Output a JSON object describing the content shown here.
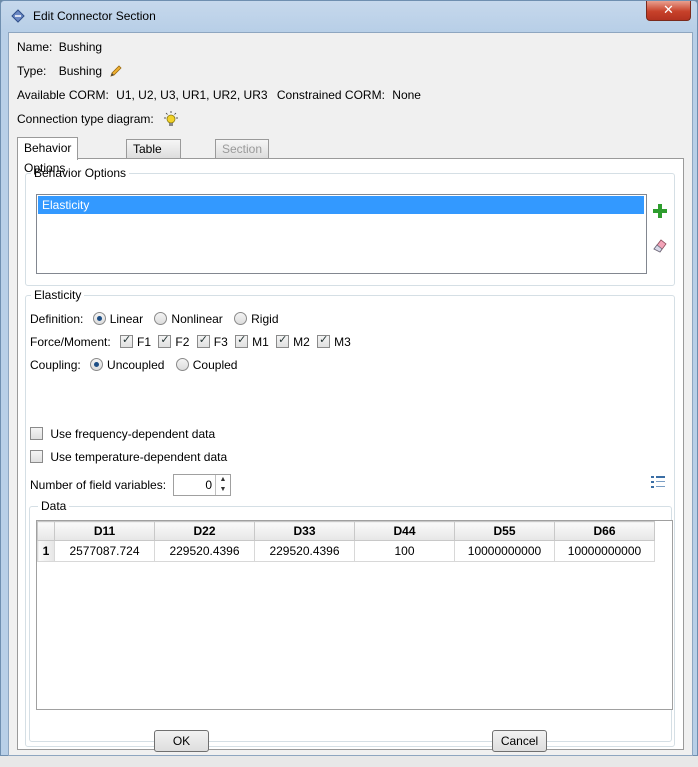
{
  "window": {
    "title": "Edit Connector Section",
    "close_label": "✕"
  },
  "info": {
    "name_label": "Name:",
    "name_value": "Bushing",
    "type_label": "Type:",
    "type_value": "Bushing",
    "available_corm_label": "Available CORM:",
    "available_corm_value": "U1, U2, U3, UR1, UR2, UR3",
    "constrained_corm_label": "Constrained CORM:",
    "constrained_corm_value": "None",
    "diagram_label": "Connection type diagram:"
  },
  "tabs": [
    {
      "label": "Behavior Options",
      "state": "active"
    },
    {
      "label": "Table Options",
      "state": "normal"
    },
    {
      "label": "Section Data",
      "state": "disabled"
    }
  ],
  "behavior_options": {
    "group_label": "Behavior Options",
    "items": [
      "Elasticity"
    ],
    "selected": "Elasticity"
  },
  "elasticity": {
    "group_label": "Elasticity",
    "definition_label": "Definition:",
    "definition_options": [
      "Linear",
      "Nonlinear",
      "Rigid"
    ],
    "definition_selected": "Linear",
    "force_moment_label": "Force/Moment:",
    "force_moment_options": [
      {
        "label": "F1",
        "checked": true
      },
      {
        "label": "F2",
        "checked": true
      },
      {
        "label": "F3",
        "checked": true
      },
      {
        "label": "M1",
        "checked": true
      },
      {
        "label": "M2",
        "checked": true
      },
      {
        "label": "M3",
        "checked": true
      }
    ],
    "coupling_label": "Coupling:",
    "coupling_options": [
      "Uncoupled",
      "Coupled"
    ],
    "coupling_selected": "Uncoupled",
    "freq_dependent_label": "Use frequency-dependent data",
    "freq_dependent_checked": false,
    "temp_dependent_label": "Use temperature-dependent data",
    "temp_dependent_checked": false,
    "field_vars_label": "Number of field variables:",
    "field_vars_value": "0"
  },
  "data_table": {
    "group_label": "Data",
    "columns": [
      "D11",
      "D22",
      "D33",
      "D44",
      "D55",
      "D66"
    ],
    "rows": [
      {
        "index": "1",
        "cells": [
          "2577087.724",
          "229520.4396",
          "229520.4396",
          "100",
          "10000000000",
          "10000000000"
        ]
      }
    ]
  },
  "footer": {
    "ok_label": "OK",
    "cancel_label": "Cancel"
  },
  "colors": {
    "selection": "#3399ff",
    "add_icon": "#2e9d2e",
    "hint_icon": "#f2d22a"
  },
  "icons": [
    "pencil-icon",
    "lightbulb-icon",
    "add-icon",
    "eraser-icon",
    "table-options-icon"
  ]
}
